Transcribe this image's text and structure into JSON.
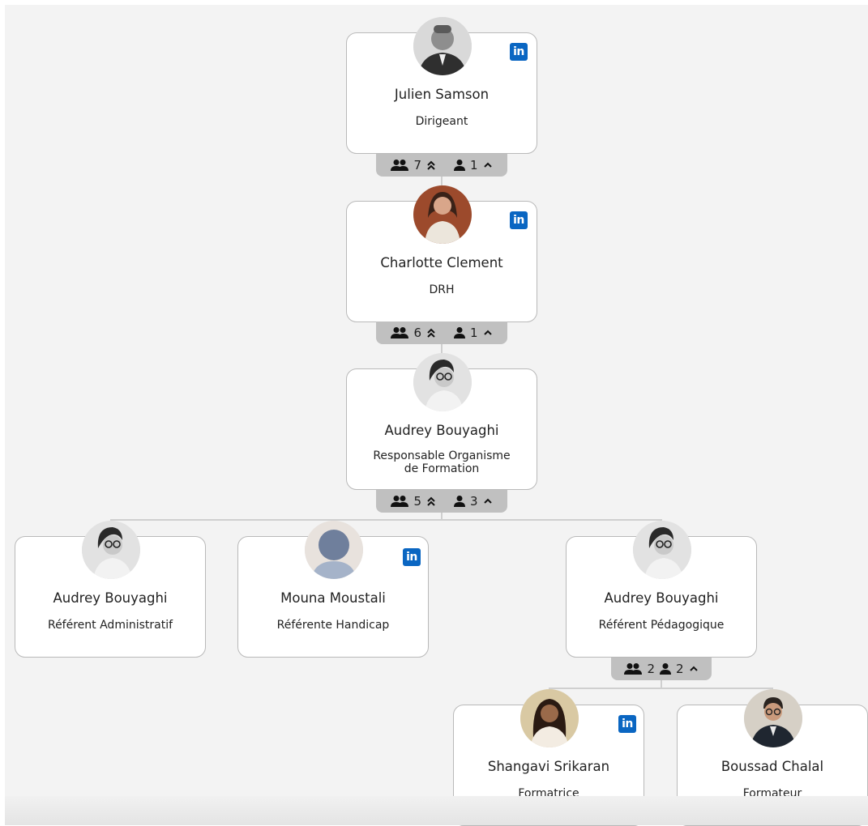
{
  "cards": [
    {
      "name": "Julien Samson",
      "role": "Dirigeant",
      "linkedin": true,
      "avatar": "man-photo"
    },
    {
      "name": "Charlotte Clement",
      "role": "DRH",
      "linkedin": true,
      "avatar": "woman-photo"
    },
    {
      "name": "Audrey Bouyaghi",
      "role_line1": "Responsable Organisme",
      "role_line2": "de Formation",
      "linkedin": false,
      "avatar": "woman-glasses-photo"
    },
    {
      "name": "Audrey Bouyaghi",
      "role": "Référent Administratif",
      "linkedin": false,
      "avatar": "woman-glasses-photo"
    },
    {
      "name": "Mouna Moustali",
      "role": "Référente Handicap",
      "linkedin": true,
      "avatar": "default-avatar"
    },
    {
      "name": "Audrey Bouyaghi",
      "role": "Référent Pédagogique",
      "linkedin": false,
      "avatar": "woman-glasses-photo"
    },
    {
      "name": "Shangavi Srikaran",
      "role": "Formatrice",
      "linkedin": true,
      "avatar": "woman-photo"
    },
    {
      "name": "Boussad Chalal",
      "role": "Formateur",
      "linkedin": false,
      "avatar": "man-glasses-photo"
    }
  ],
  "linkedin_label": "in",
  "stats": [
    {
      "team": "7",
      "direct": "1"
    },
    {
      "team": "6",
      "direct": "1"
    },
    {
      "team": "5",
      "direct": "3"
    },
    {
      "team": "2",
      "direct": "2"
    }
  ],
  "icons": {
    "team": "group-icon",
    "direct": "person-icon",
    "expand_all": "double-chevron-up-icon",
    "collapse": "chevron-up-icon",
    "linkedin": "linkedin-icon"
  },
  "colors": {
    "linkedin": "#0a66c2",
    "stats_bar": "#c0c0c0",
    "card_border": "#b9b9b9",
    "background": "#f3f3f3"
  }
}
